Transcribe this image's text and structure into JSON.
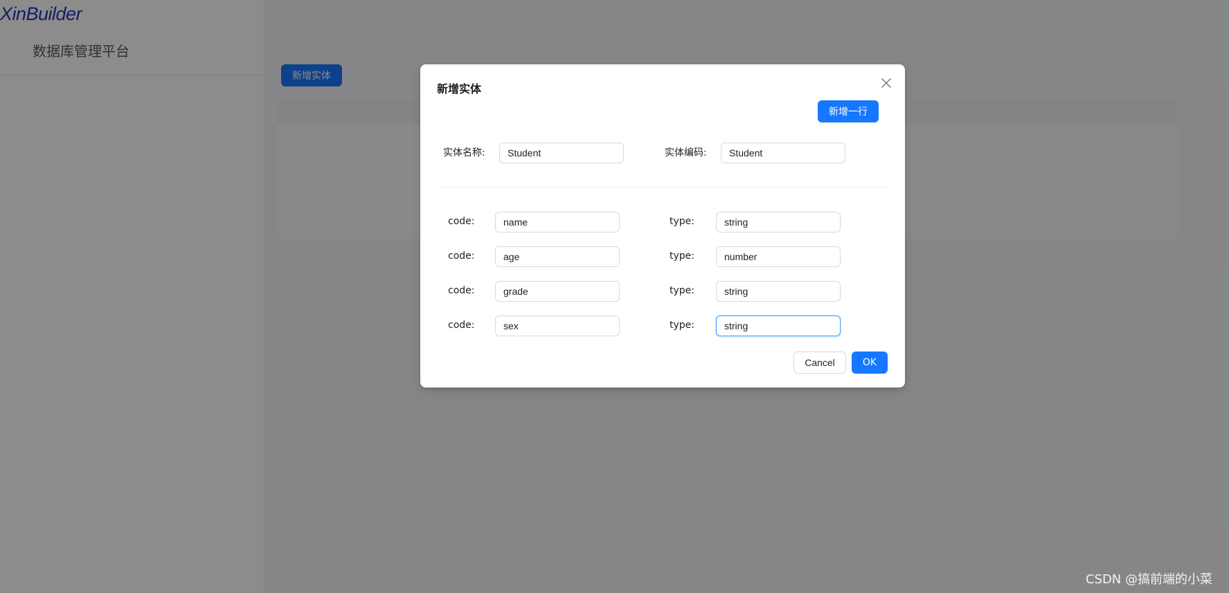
{
  "sider": {
    "logo": "XinBuilder",
    "subtitle": "数据库管理平台"
  },
  "main": {
    "add_entity_label": "新增实体"
  },
  "modal": {
    "title": "新增实体",
    "add_row_label": "新增一行",
    "entity_name_label": "实体名称:",
    "entity_name_value": "Student",
    "entity_code_label": "实体编码:",
    "entity_code_value": "Student",
    "rows": [
      {
        "code_label": "code:",
        "code": "name",
        "type_label": "type:",
        "type": "string"
      },
      {
        "code_label": "code:",
        "code": "age",
        "type_label": "type:",
        "type": "number"
      },
      {
        "code_label": "code:",
        "code": "grade",
        "type_label": "type:",
        "type": "string"
      },
      {
        "code_label": "code:",
        "code": "sex",
        "type_label": "type:",
        "type": "string"
      }
    ],
    "cancel_label": "Cancel",
    "ok_label": "OK"
  },
  "watermark": "CSDN @搞前端的小菜",
  "colors": {
    "primary": "#1677ff",
    "logo": "#2a35b8",
    "mask": "rgba(0,0,0,0.45)"
  },
  "icons": {
    "close": "close-icon"
  }
}
